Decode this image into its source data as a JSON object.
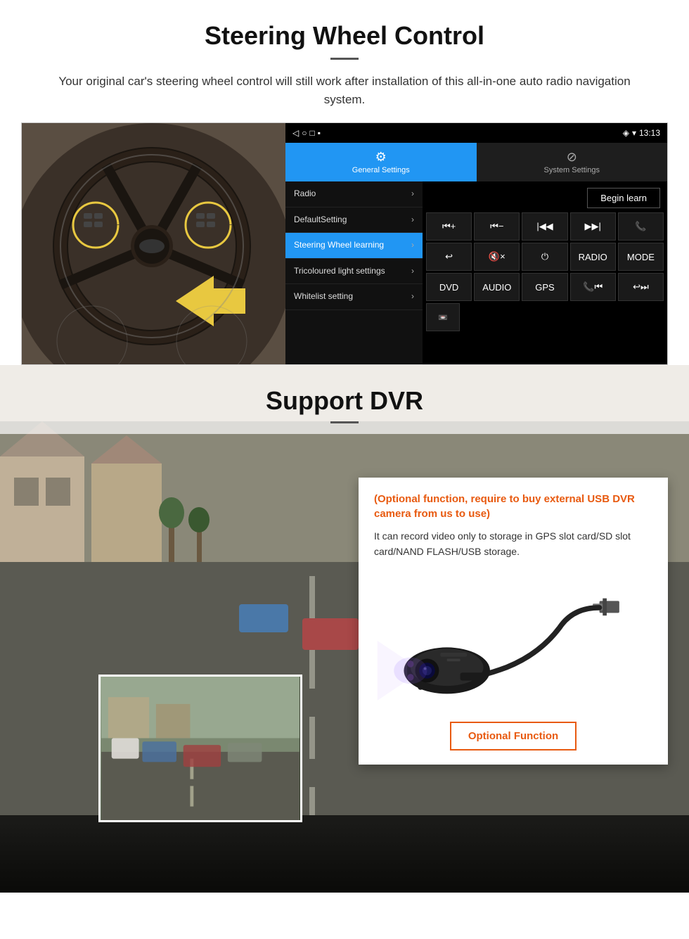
{
  "page": {
    "section1": {
      "title": "Steering Wheel Control",
      "subtitle_divider": true,
      "description": "Your original car's steering wheel control will still work after installation of this all-in-one auto radio navigation system.",
      "android_ui": {
        "statusbar": {
          "time": "13:13",
          "icons": [
            "location-icon",
            "wifi-icon"
          ]
        },
        "nav_icons": [
          "back-icon",
          "home-icon",
          "recent-icon",
          "camera-icon"
        ],
        "tabs": [
          {
            "label": "General Settings",
            "active": true,
            "icon": "gear"
          },
          {
            "label": "System Settings",
            "active": false,
            "icon": "wifi-settings"
          }
        ],
        "menu_items": [
          {
            "label": "Radio",
            "active": false
          },
          {
            "label": "DefaultSetting",
            "active": false
          },
          {
            "label": "Steering Wheel learning",
            "active": true
          },
          {
            "label": "Tricoloured light settings",
            "active": false
          },
          {
            "label": "Whitelist setting",
            "active": false
          }
        ],
        "begin_learn_label": "Begin learn",
        "control_buttons": {
          "row1": [
            "⏮+",
            "⏮−",
            "⏮|",
            "|⏭",
            "📞"
          ],
          "row2": [
            "↩",
            "🔇×",
            "⏻",
            "RADIO",
            "MODE"
          ],
          "row3": [
            "DVD",
            "AUDIO",
            "GPS",
            "📞|⏮",
            "↩|⏭"
          ],
          "row4_single": "📼"
        }
      }
    },
    "section2": {
      "title": "Support DVR",
      "subtitle_divider": true,
      "card": {
        "optional_text": "(Optional function, require to buy external USB DVR camera from us to use)",
        "desc_text": "It can record video only to storage in GPS slot card/SD slot card/NAND FLASH/USB storage.",
        "button_label": "Optional Function"
      }
    }
  }
}
